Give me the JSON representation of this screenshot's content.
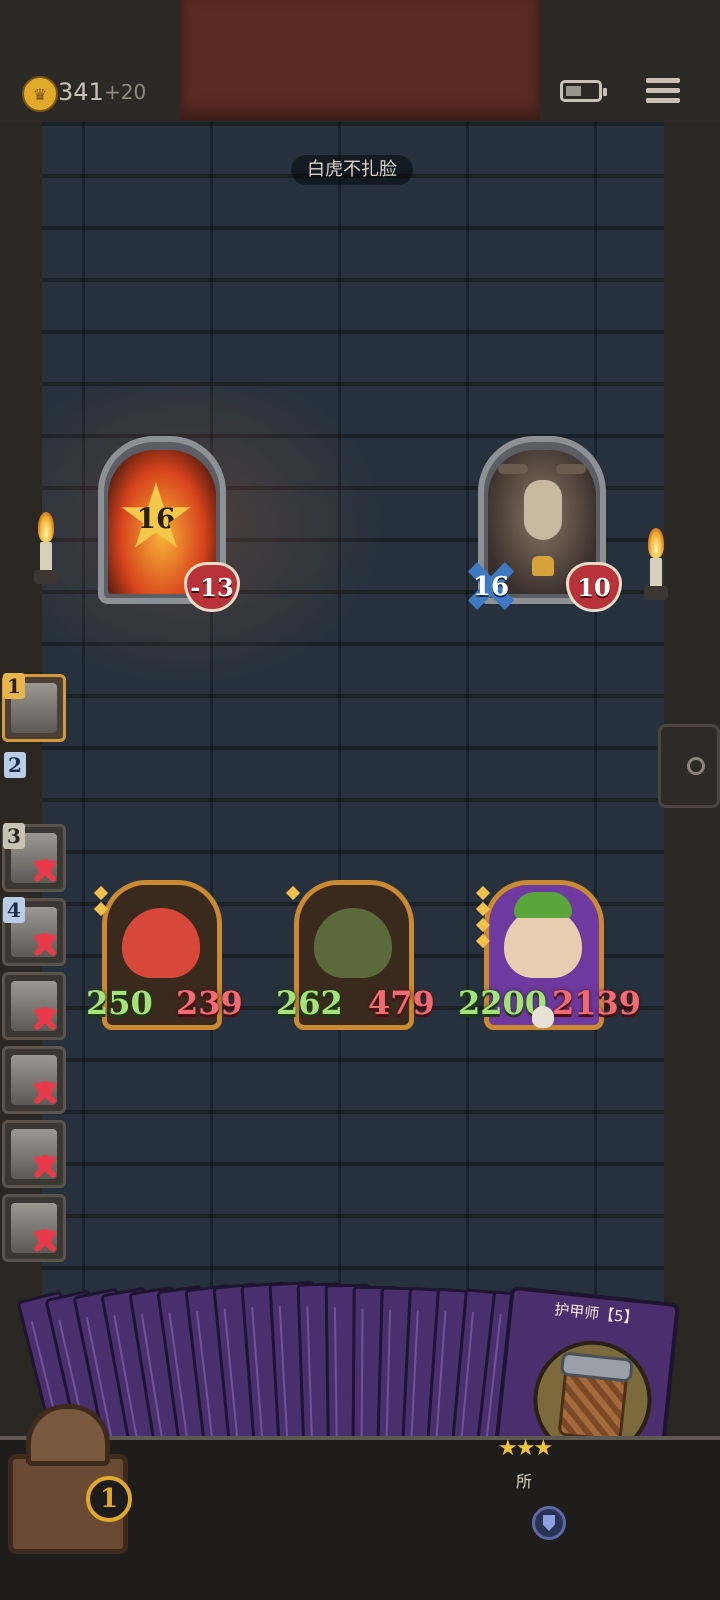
{
  "top_bar": {
    "gold": "341",
    "gold_bonus": "+20",
    "battery_level": 0.45
  },
  "room": {
    "title": "白虎不扎脸"
  },
  "enemies": [
    {
      "name": "fire-spirit",
      "attack": "16",
      "health": "-13"
    },
    {
      "name": "goat-bellkeeper",
      "armor": "16",
      "health": "10"
    }
  ],
  "turn_queue": [
    {
      "order": "1",
      "defeated": false,
      "active": true
    },
    {
      "order": "2",
      "defeated": false,
      "active": false
    },
    {
      "order": "3",
      "defeated": true,
      "active": false
    },
    {
      "order": "4",
      "defeated": true,
      "active": false
    },
    {
      "order": "",
      "defeated": true,
      "active": false
    },
    {
      "order": "",
      "defeated": true,
      "active": false
    },
    {
      "order": "",
      "defeated": true,
      "active": false
    },
    {
      "order": "",
      "defeated": true,
      "active": false
    }
  ],
  "heroes": [
    {
      "name": "red-imp",
      "attack": "250",
      "health": "239"
    },
    {
      "name": "goblin-witch",
      "attack": "262",
      "health": "479"
    },
    {
      "name": "leaf-girl",
      "attack": "2200",
      "health": "2139"
    }
  ],
  "deck": {
    "lead_card_title": "护甲师【5】",
    "lead_card_stars": 3,
    "lead_card_text": "所"
  },
  "chest": {
    "count": "1"
  },
  "colors": {
    "attack_text": "#a4e27a",
    "health_text": "#f06b72",
    "gold_coin": "#e0a92a",
    "card_back": "#4a2f6e"
  }
}
